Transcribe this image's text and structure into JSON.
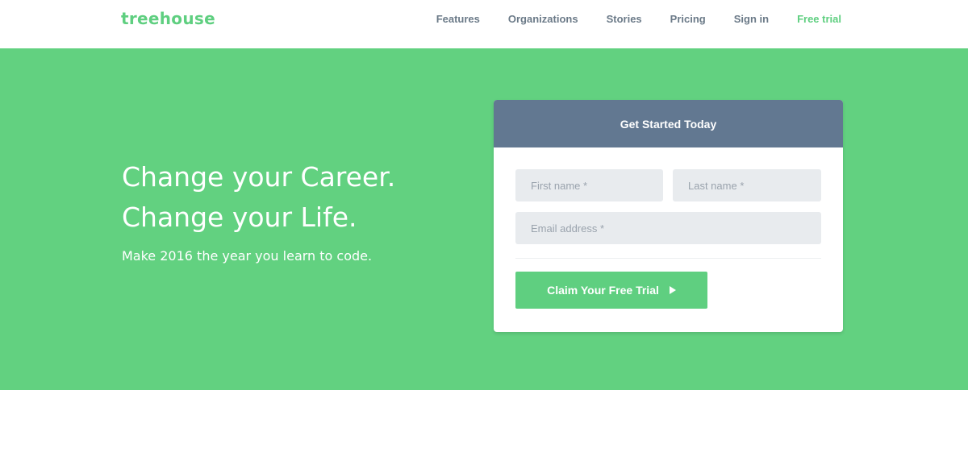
{
  "header": {
    "logo": "treehouse",
    "nav": [
      {
        "label": "Features"
      },
      {
        "label": "Organizations"
      },
      {
        "label": "Stories"
      },
      {
        "label": "Pricing"
      },
      {
        "label": "Sign in"
      },
      {
        "label": "Free trial"
      }
    ]
  },
  "hero": {
    "headline_1": "Change your Career.",
    "headline_2": "Change your Life.",
    "subheadline": "Make 2016 the year you learn to code."
  },
  "form": {
    "title": "Get Started Today",
    "first_name_placeholder": "First name *",
    "last_name_placeholder": "Last name *",
    "email_placeholder": "Email address *",
    "submit_label": "Claim Your Free Trial",
    "submit_icon": "play-arrow-icon"
  },
  "colors": {
    "brand_green": "#5fcf80",
    "hero_background": "#62d180",
    "card_header": "#627891",
    "nav_text": "#6b7a88"
  }
}
